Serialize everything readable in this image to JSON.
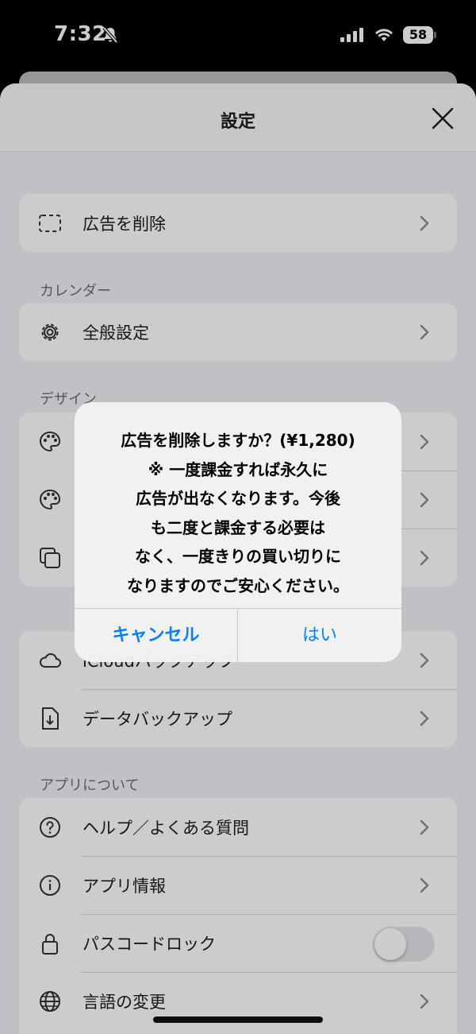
{
  "status_bar": {
    "time": "7:32",
    "battery": "58"
  },
  "sheet": {
    "title": "設定"
  },
  "groups": {
    "ads": {
      "items": [
        {
          "label": "広告を削除",
          "icon": "dashed-square-icon"
        }
      ]
    },
    "calendar": {
      "header": "カレンダー",
      "items": [
        {
          "label": "全般設定",
          "icon": "gear-icon"
        }
      ]
    },
    "design": {
      "header": "デザイン",
      "items": [
        {
          "label": "",
          "icon": "palette-icon"
        },
        {
          "label": "",
          "icon": "palette-icon"
        },
        {
          "label": "",
          "icon": "copy-icon"
        }
      ]
    },
    "backup": {
      "items": [
        {
          "label": "iCloudバックアップ",
          "icon": "cloud-icon"
        },
        {
          "label": "データバックアップ",
          "icon": "document-download-icon"
        }
      ]
    },
    "about": {
      "header": "アプリについて",
      "items": [
        {
          "label": "ヘルプ／よくある質問",
          "icon": "question-circle-icon"
        },
        {
          "label": "アプリ情報",
          "icon": "info-circle-icon"
        },
        {
          "label": "パスコードロック",
          "icon": "lock-icon",
          "toggle": false
        },
        {
          "label": "言語の変更",
          "icon": "globe-icon"
        }
      ]
    }
  },
  "alert": {
    "message": "広告を削除しますか？(¥1,280)\n※ 一度課金すれば永久に\n広告が出なくなります。今後\nも二度と課金する必要は\nなく、一度きりの買い切りに\nなりますのでご安心ください。",
    "cancel_label": "キャンセル",
    "confirm_label": "はい"
  },
  "colors": {
    "accent": "#0a7ff5",
    "background": "#f2f2f7"
  }
}
